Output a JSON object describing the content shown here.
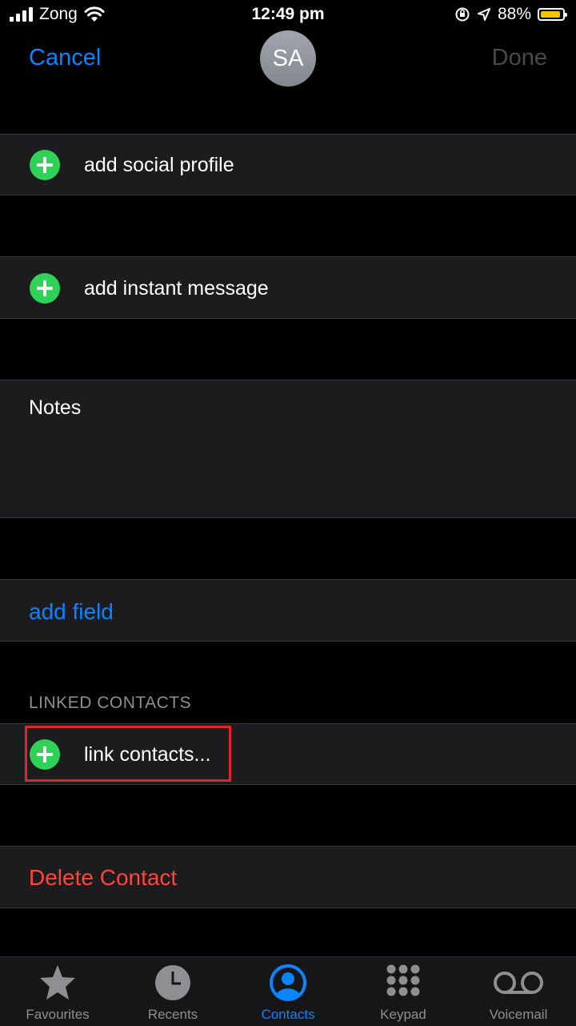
{
  "status_bar": {
    "carrier": "Zong",
    "time": "12:49 pm",
    "battery": "88%",
    "battery_color": "#f5c400"
  },
  "nav": {
    "cancel": "Cancel",
    "avatar_initials": "SA",
    "done": "Done"
  },
  "rows": {
    "add_social_profile": "add social profile",
    "add_instant_message": "add instant message",
    "notes": "Notes",
    "add_field": "add field",
    "linked_contacts_header": "LINKED CONTACTS",
    "link_contacts": "link contacts...",
    "delete_contact": "Delete Contact"
  },
  "colors": {
    "accent": "#0a84ff",
    "destructive": "#ff453a",
    "add": "#30d158",
    "highlight": "#e0242c"
  },
  "tabbar": {
    "tabs": [
      {
        "label": "Favourites",
        "icon": "star-icon"
      },
      {
        "label": "Recents",
        "icon": "clock-icon"
      },
      {
        "label": "Contacts",
        "icon": "person-circle-icon",
        "active": true
      },
      {
        "label": "Keypad",
        "icon": "keypad-icon"
      },
      {
        "label": "Voicemail",
        "icon": "voicemail-icon"
      }
    ]
  }
}
